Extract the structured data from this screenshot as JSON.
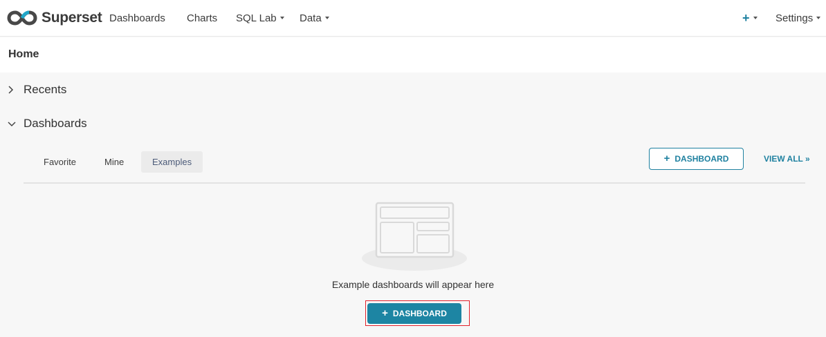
{
  "navbar": {
    "brand": "Superset",
    "items": [
      {
        "label": "Dashboards",
        "has_caret": false
      },
      {
        "label": "Charts",
        "has_caret": false
      },
      {
        "label": "SQL Lab",
        "has_caret": true
      },
      {
        "label": "Data",
        "has_caret": true
      }
    ],
    "plus_icon": "+",
    "settings_label": "Settings"
  },
  "page": {
    "title": "Home"
  },
  "sections": {
    "recents_label": "Recents",
    "dashboards_label": "Dashboards"
  },
  "dashboards": {
    "tabs": [
      {
        "label": "Favorite",
        "active": false
      },
      {
        "label": "Mine",
        "active": false
      },
      {
        "label": "Examples",
        "active": true
      }
    ],
    "add_button_label": "DASHBOARD",
    "view_all_label": "VIEW ALL »",
    "empty_text": "Example dashboards will appear here",
    "empty_button_label": "DASHBOARD"
  },
  "colors": {
    "accent": "#1f81a0",
    "highlight": "#e0202a"
  }
}
